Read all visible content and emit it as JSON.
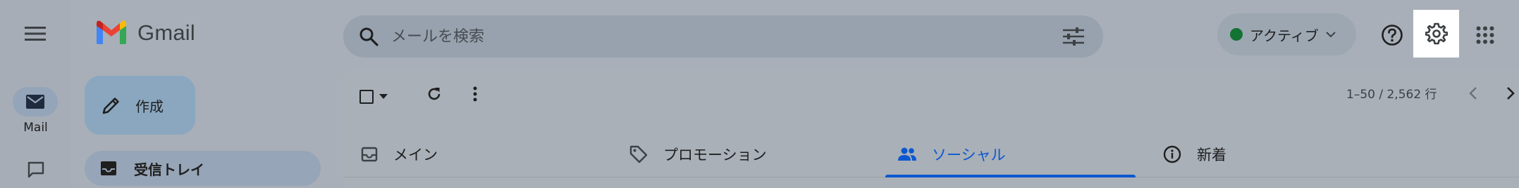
{
  "app": {
    "logo_text": "Gmail"
  },
  "nav": {
    "mail_label": "Mail"
  },
  "search": {
    "placeholder": "メールを検索"
  },
  "header": {
    "status_label": "アクティブ"
  },
  "compose": {
    "label": "作成"
  },
  "sidebar": {
    "items": [
      {
        "label": "受信トレイ",
        "icon": "inbox-icon"
      }
    ]
  },
  "toolbar": {
    "pagination": "1–50 / 2,562 行"
  },
  "tabs": [
    {
      "label": "メイン",
      "icon": "inbox-icon"
    },
    {
      "label": "プロモーション",
      "icon": "tag-icon"
    },
    {
      "label": "ソーシャル",
      "icon": "people-icon",
      "active": true
    },
    {
      "label": "新着",
      "icon": "info-icon"
    }
  ],
  "colors": {
    "active_tab": "#0b57d0",
    "status_dot": "#137333",
    "overlay": "#a8afb8"
  }
}
